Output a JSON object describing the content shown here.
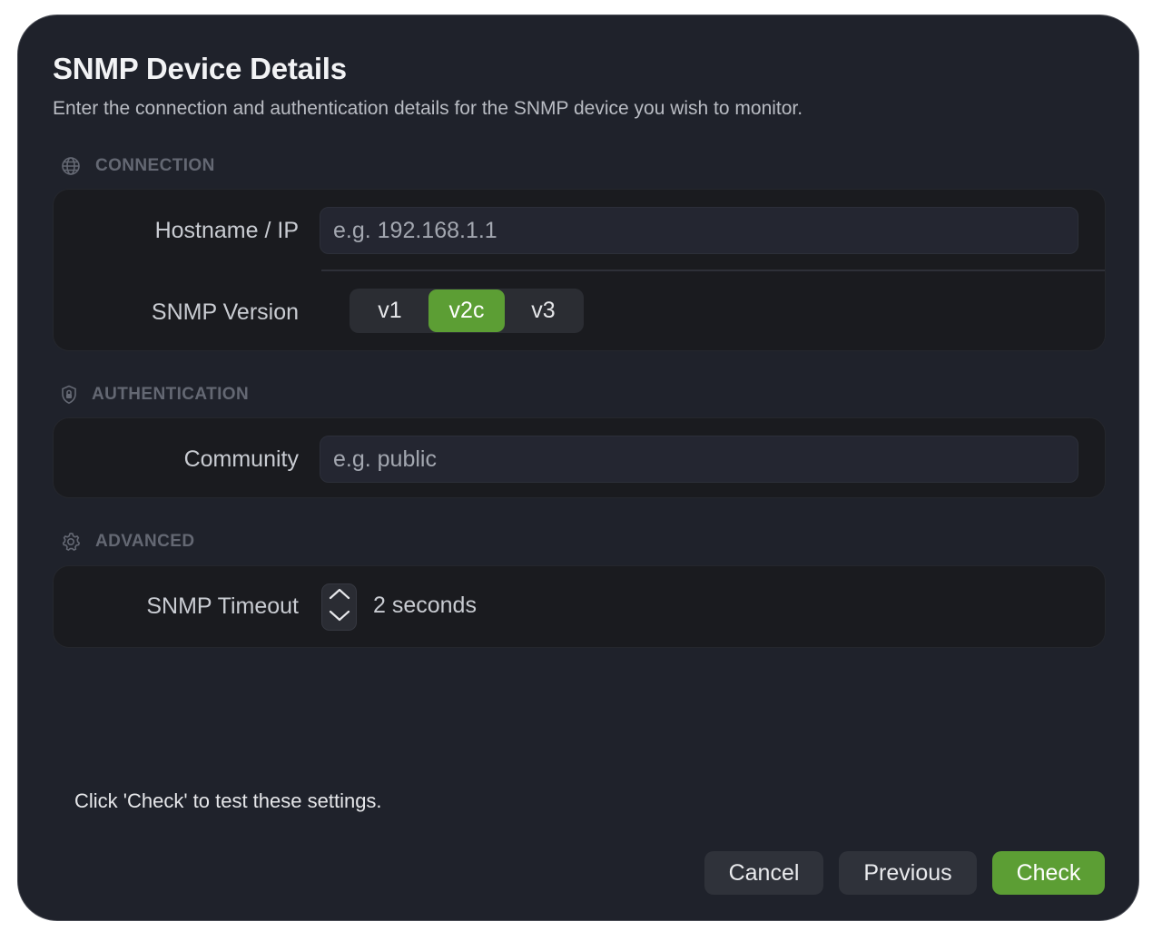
{
  "dialog": {
    "title": "SNMP Device Details",
    "subtitle": "Enter the connection and authentication details for the SNMP device you wish to monitor."
  },
  "sections": {
    "connection": {
      "label": "CONNECTION",
      "icon": "globe-icon"
    },
    "authentication": {
      "label": "AUTHENTICATION",
      "icon": "shield-lock-icon"
    },
    "advanced": {
      "label": "ADVANCED",
      "icon": "gear-icon"
    }
  },
  "fields": {
    "hostname": {
      "label": "Hostname / IP",
      "value": "",
      "placeholder": "e.g. 192.168.1.1"
    },
    "snmp_version": {
      "label": "SNMP Version",
      "options": [
        "v1",
        "v2c",
        "v3"
      ],
      "selected": "v2c"
    },
    "community": {
      "label": "Community",
      "value": "",
      "placeholder": "e.g. public"
    },
    "timeout": {
      "label": "SNMP Timeout",
      "value_text": "2 seconds"
    }
  },
  "hint": "Click 'Check' to test these settings.",
  "buttons": {
    "cancel": "Cancel",
    "previous": "Previous",
    "check": "Check"
  },
  "colors": {
    "accent": "#5c9e34",
    "background": "#1f222b",
    "group_background": "#1a1b1f",
    "section_header": "#646873"
  }
}
